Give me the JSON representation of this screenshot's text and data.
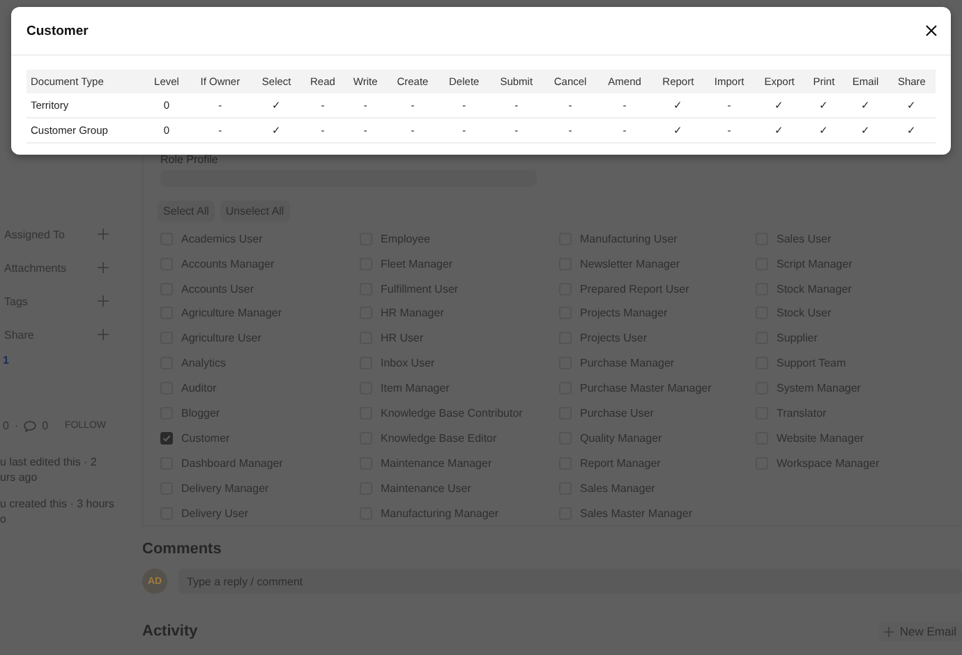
{
  "dialog": {
    "title": "Customer",
    "table": {
      "columns": [
        "Document Type",
        "Level",
        "If Owner",
        "Select",
        "Read",
        "Write",
        "Create",
        "Delete",
        "Submit",
        "Cancel",
        "Amend",
        "Report",
        "Import",
        "Export",
        "Print",
        "Email",
        "Share"
      ],
      "rows": [
        {
          "cells": [
            "Territory",
            "0",
            "-",
            "✓",
            "-",
            "-",
            "-",
            "-",
            "-",
            "-",
            "-",
            "✓",
            "-",
            "✓",
            "✓",
            "✓",
            "✓"
          ]
        },
        {
          "cells": [
            "Customer Group",
            "0",
            "-",
            "✓",
            "-",
            "-",
            "-",
            "-",
            "-",
            "-",
            "-",
            "✓",
            "-",
            "✓",
            "✓",
            "✓",
            "✓"
          ]
        }
      ]
    }
  },
  "sidebar": {
    "items": [
      {
        "label": "Assigned To"
      },
      {
        "label": "Attachments"
      },
      {
        "label": "Tags"
      },
      {
        "label": "Share"
      }
    ],
    "link": "1",
    "likes": "0",
    "separator": "·",
    "comments": "0",
    "follow": "FOLLOW",
    "timeline": [
      [
        "u last edited this · 2",
        "urs ago"
      ],
      [
        "u created this · 3 hours",
        "o"
      ]
    ]
  },
  "role_profile": {
    "label": "Role Profile"
  },
  "buttons": [
    "Select All",
    "Unselect All"
  ],
  "roles": [
    {
      "label": "Academics User",
      "checked": false
    },
    {
      "label": "Accounts Manager",
      "checked": false
    },
    {
      "label": "Accounts User",
      "checked": false
    },
    {
      "label": "Agriculture Manager",
      "checked": false
    },
    {
      "label": "Agriculture User",
      "checked": false
    },
    {
      "label": "Analytics",
      "checked": false
    },
    {
      "label": "Auditor",
      "checked": false
    },
    {
      "label": "Blogger",
      "checked": false
    },
    {
      "label": "Customer",
      "checked": true
    },
    {
      "label": "Dashboard Manager",
      "checked": false
    },
    {
      "label": "Delivery Manager",
      "checked": false
    },
    {
      "label": "Delivery User",
      "checked": false
    },
    {
      "label": "Employee",
      "checked": false
    },
    {
      "label": "Fleet Manager",
      "checked": false
    },
    {
      "label": "Fulfillment User",
      "checked": false
    },
    {
      "label": "HR Manager",
      "checked": false
    },
    {
      "label": "HR User",
      "checked": false
    },
    {
      "label": "Inbox User",
      "checked": false
    },
    {
      "label": "Item Manager",
      "checked": false
    },
    {
      "label": "Knowledge Base Contributor",
      "checked": false
    },
    {
      "label": "Knowledge Base Editor",
      "checked": false
    },
    {
      "label": "Maintenance Manager",
      "checked": false
    },
    {
      "label": "Maintenance User",
      "checked": false
    },
    {
      "label": "Manufacturing Manager",
      "checked": false
    },
    {
      "label": "Manufacturing User",
      "checked": false
    },
    {
      "label": "Newsletter Manager",
      "checked": false
    },
    {
      "label": "Prepared Report User",
      "checked": false
    },
    {
      "label": "Projects Manager",
      "checked": false
    },
    {
      "label": "Projects User",
      "checked": false
    },
    {
      "label": "Purchase Manager",
      "checked": false
    },
    {
      "label": "Purchase Master Manager",
      "checked": false
    },
    {
      "label": "Purchase User",
      "checked": false
    },
    {
      "label": "Quality Manager",
      "checked": false
    },
    {
      "label": "Report Manager",
      "checked": false
    },
    {
      "label": "Sales Manager",
      "checked": false
    },
    {
      "label": "Sales Master Manager",
      "checked": false
    },
    {
      "label": "Sales User",
      "checked": false
    },
    {
      "label": "Script Manager",
      "checked": false
    },
    {
      "label": "Stock Manager",
      "checked": false
    },
    {
      "label": "Stock User",
      "checked": false
    },
    {
      "label": "Supplier",
      "checked": false
    },
    {
      "label": "Support Team",
      "checked": false
    },
    {
      "label": "System Manager",
      "checked": false
    },
    {
      "label": "Translator",
      "checked": false
    },
    {
      "label": "Website Manager",
      "checked": false
    },
    {
      "label": "Workspace Manager",
      "checked": false
    }
  ],
  "comments": {
    "title": "Comments",
    "avatar": "AD",
    "placeholder": "Type a reply / comment"
  },
  "activity": {
    "title": "Activity",
    "new_email": "New Email"
  }
}
